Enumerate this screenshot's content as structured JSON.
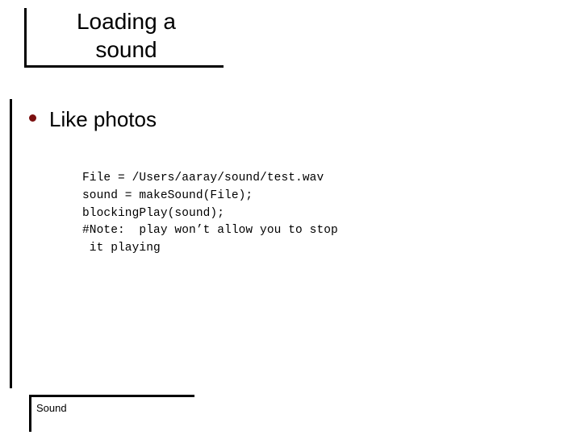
{
  "slide": {
    "background_color": "#ffffff",
    "text_color": "#000000",
    "rule_color": "#000000",
    "bullet_color": "#7B1010",
    "title": "Loading a\nsound",
    "body": {
      "bullets": [
        {
          "marker": "disc-bullet",
          "text": "Like photos"
        }
      ],
      "code": "File = /Users/aaray/sound/test.wav\nsound = makeSound(File);\nblockingPlay(sound);\n#Note:  play won’t allow you to stop\n it playing",
      "code_lines": [
        "File = /Users/aaray/sound/test.wav",
        "sound = makeSound(File);",
        "blockingPlay(sound);",
        "#Note:  play won’t allow you to stop",
        " it playing"
      ]
    },
    "footer": {
      "label": "Sound"
    }
  }
}
